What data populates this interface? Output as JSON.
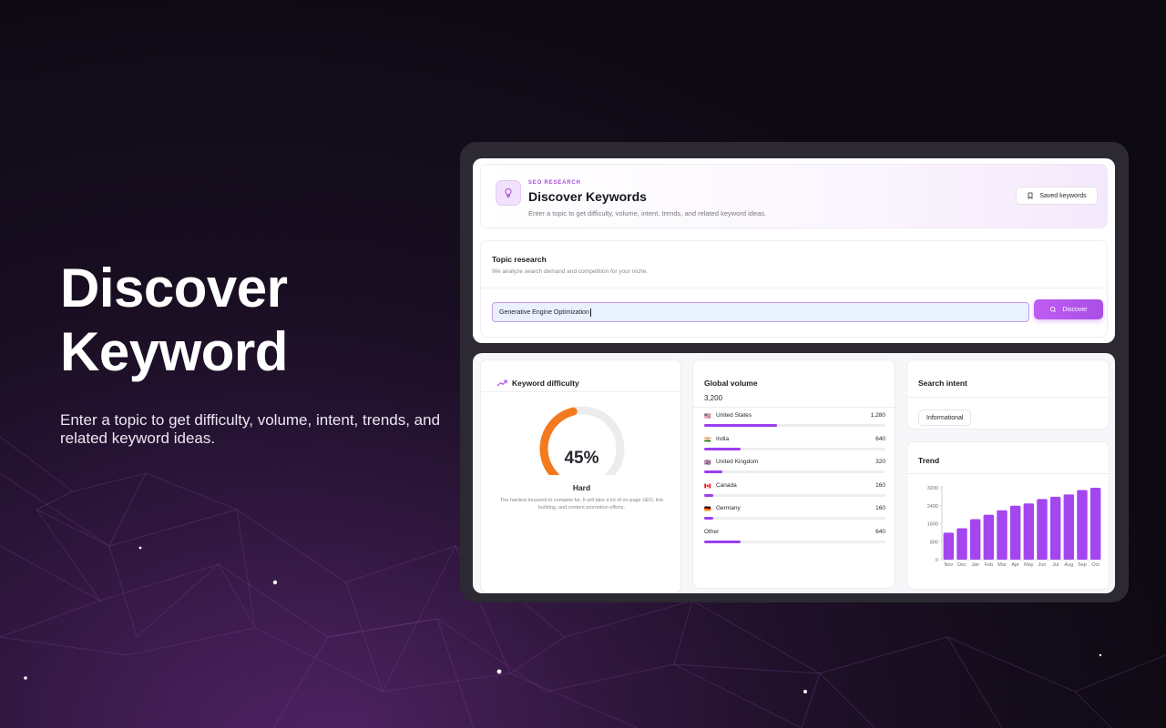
{
  "hero": {
    "title_line1": "Discover",
    "title_line2": "Keyword",
    "subtitle": "Enter a topic to get difficulty, volume, intent, trends, and related keyword ideas."
  },
  "header": {
    "eyebrow": "SEO RESEARCH",
    "title": "Discover Keywords",
    "subtitle": "Enter a topic to get difficulty, volume, intent, trends, and related keyword ideas.",
    "saved_label": "Saved keywords",
    "icon": "lightbulb-icon"
  },
  "topic": {
    "title": "Topic research",
    "subtitle": "We analyze search demand and competition for your niche.",
    "input_value": "Generative Engine Optimization",
    "discover_label": "Discover"
  },
  "difficulty": {
    "title": "Keyword difficulty",
    "value": 45,
    "value_text": "45%",
    "level": "Hard",
    "description": "The hardest keyword to compete for. It will take a lot of on-page SEO, link building, and content promotion efforts.",
    "gauge_color": "#f47a1f"
  },
  "volume": {
    "title": "Global volume",
    "total": "3,200",
    "rows": [
      {
        "flag": "🇺🇸",
        "country": "United States",
        "count": "1,280",
        "share": 0.4
      },
      {
        "flag": "🇮🇳",
        "country": "India",
        "count": "640",
        "share": 0.2
      },
      {
        "flag": "🇬🇧",
        "country": "United Kingdom",
        "count": "320",
        "share": 0.1
      },
      {
        "flag": "🇨🇦",
        "country": "Canada",
        "count": "160",
        "share": 0.05
      },
      {
        "flag": "🇩🇪",
        "country": "Germany",
        "count": "160",
        "share": 0.05
      },
      {
        "flag": "",
        "country": "Other",
        "count": "640",
        "share": 0.2
      }
    ],
    "bar_color": "#9b3ef0"
  },
  "intent": {
    "title": "Search intent",
    "value": "Informational"
  },
  "trend": {
    "title": "Trend"
  },
  "chart_data": {
    "type": "bar",
    "categories": [
      "Nov",
      "Dec",
      "Jan",
      "Feb",
      "Mar",
      "Apr",
      "May",
      "Jun",
      "Jul",
      "Aug",
      "Sep",
      "Oct"
    ],
    "values": [
      1200,
      1400,
      1800,
      2000,
      2200,
      2400,
      2500,
      2700,
      2800,
      2900,
      3100,
      3200
    ],
    "yticks": [
      0,
      800,
      1600,
      2400,
      3200
    ],
    "ylim": [
      0,
      3200
    ],
    "color": "#a545f0",
    "grid": false,
    "title": "",
    "xlabel": "",
    "ylabel": ""
  }
}
